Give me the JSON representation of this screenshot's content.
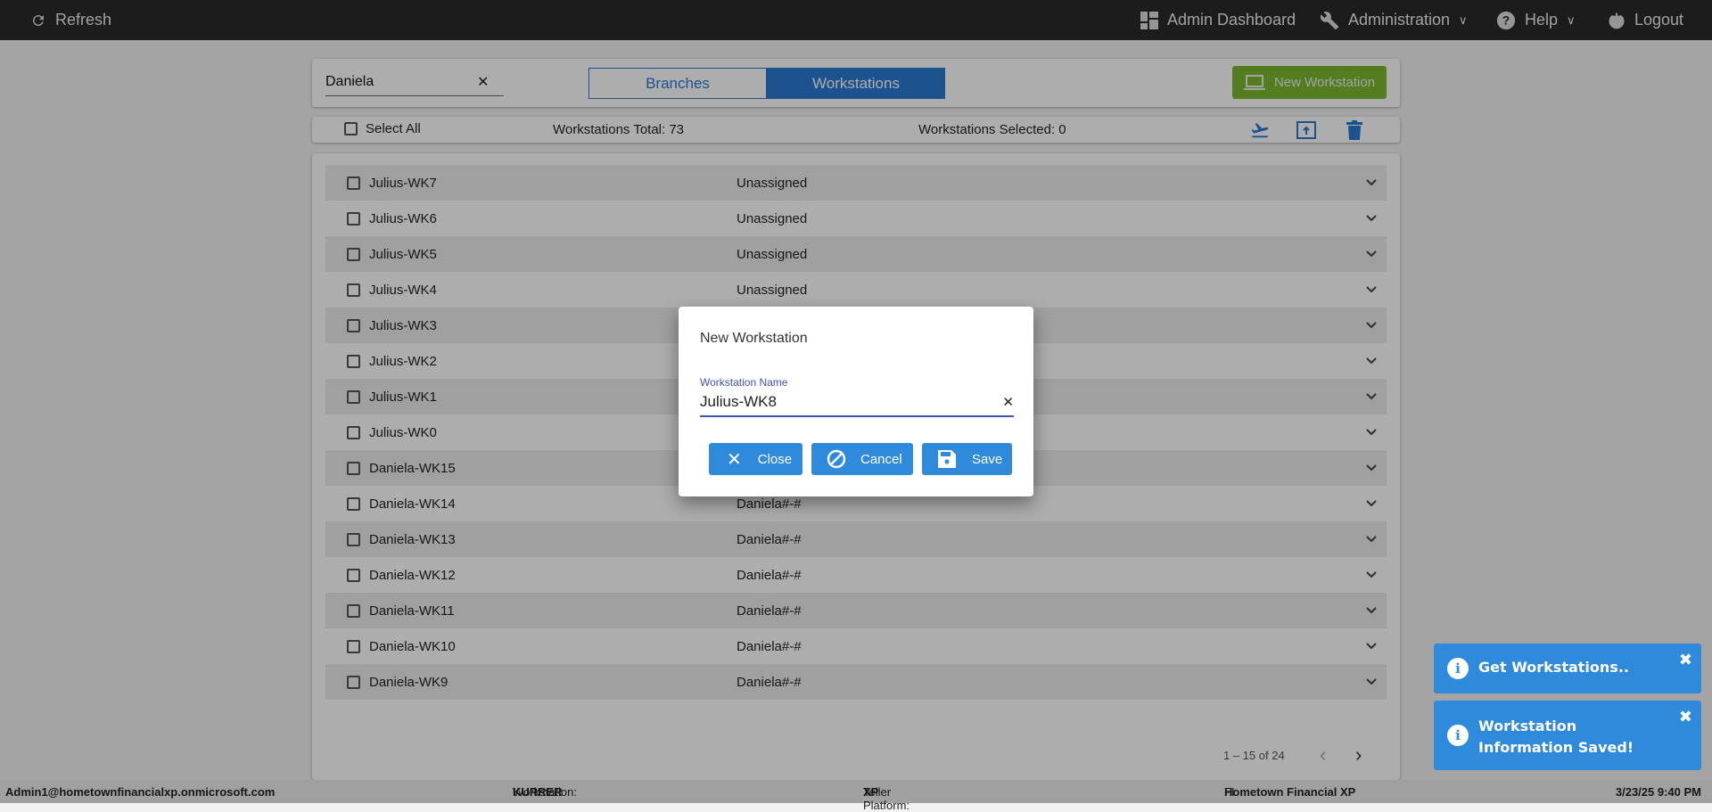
{
  "topbar": {
    "refresh": "Refresh",
    "admin_dashboard": "Admin Dashboard",
    "administration": "Administration",
    "help": "Help",
    "logout": "Logout"
  },
  "search": {
    "value": "Daniela"
  },
  "tabs": [
    "Branches",
    "Workstations"
  ],
  "new_workstation": "New Workstation",
  "toolbar": {
    "select_all": "Select All",
    "total": "Workstations Total: 73",
    "selected": "Workstations Selected: 0"
  },
  "rows": [
    {
      "name": "Julius-WK7",
      "branch": "Unassigned"
    },
    {
      "name": "Julius-WK6",
      "branch": "Unassigned"
    },
    {
      "name": "Julius-WK5",
      "branch": "Unassigned"
    },
    {
      "name": "Julius-WK4",
      "branch": "Unassigned"
    },
    {
      "name": "Julius-WK3",
      "branch": ""
    },
    {
      "name": "Julius-WK2",
      "branch": ""
    },
    {
      "name": "Julius-WK1",
      "branch": ""
    },
    {
      "name": "Julius-WK0",
      "branch": ""
    },
    {
      "name": "Daniela-WK15",
      "branch": ""
    },
    {
      "name": "Daniela-WK14",
      "branch": "Daniela#-#"
    },
    {
      "name": "Daniela-WK13",
      "branch": "Daniela#-#"
    },
    {
      "name": "Daniela-WK12",
      "branch": "Daniela#-#"
    },
    {
      "name": "Daniela-WK11",
      "branch": "Daniela#-#"
    },
    {
      "name": "Daniela-WK10",
      "branch": "Daniela#-#"
    },
    {
      "name": "Daniela-WK9",
      "branch": "Daniela#-#"
    }
  ],
  "pagination": {
    "range": "1 – 15 of 24"
  },
  "status": {
    "user": "Admin1@hometownfinancialxp.onmicrosoft.com",
    "workstation_label": "Workstation: ",
    "workstation": "KURRER",
    "platform_label": "Teller Platform: ",
    "platform": "XP",
    "fi_label": "FI: ",
    "fi": "Hometown Financial XP",
    "datetime": "3/23/25 9:40 PM"
  },
  "dialog": {
    "title": "New Workstation",
    "field_label": "Workstation Name",
    "field_value": "Julius-WK8",
    "close": "Close",
    "cancel": "Cancel",
    "save": "Save"
  },
  "toasts": [
    "Get Workstations..",
    "Workstation Information Saved!"
  ],
  "colors": {
    "accent": "#2a7ad2",
    "button": "#2f8adb",
    "new_button": "#7cb82f",
    "topbar": "#2a2a2a",
    "field_focus": "#3f51b5"
  }
}
